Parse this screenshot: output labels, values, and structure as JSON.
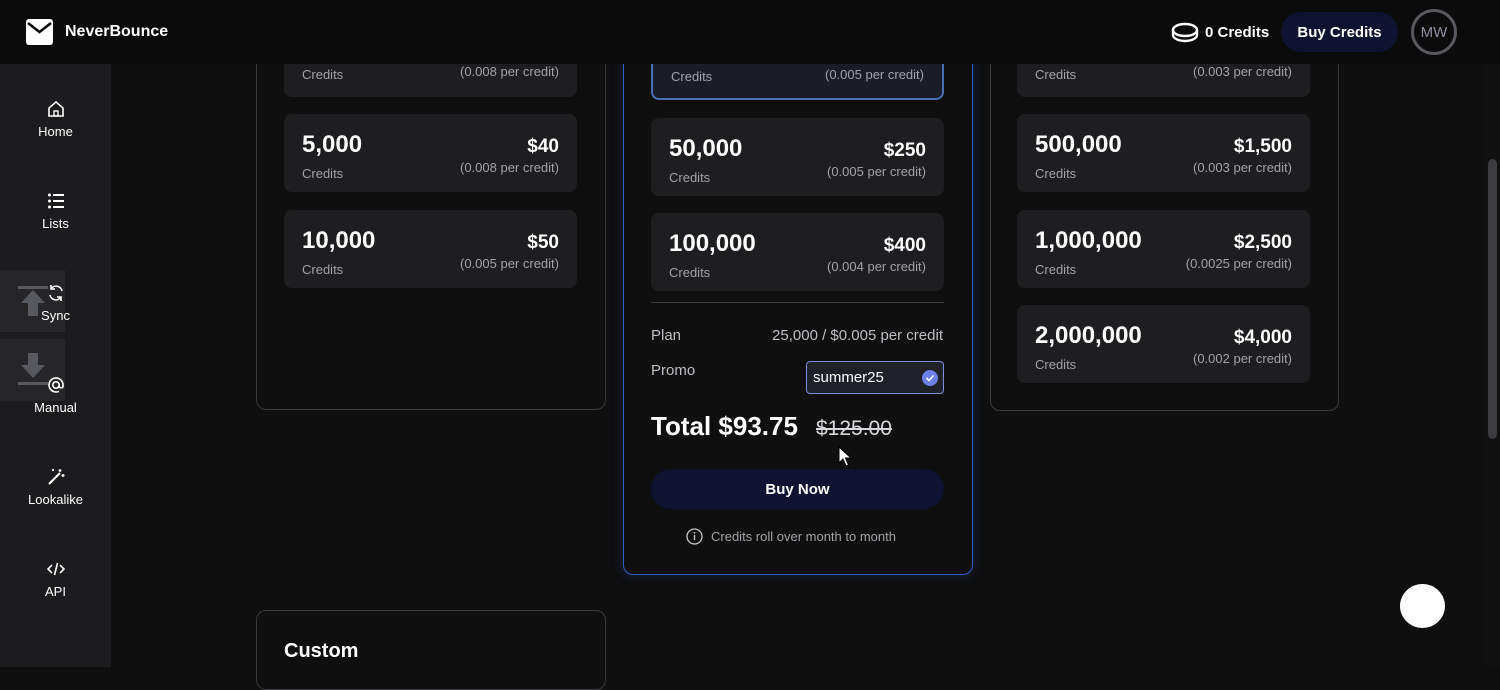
{
  "header": {
    "brand": "NeverBounce",
    "credits_text": "0 Credits",
    "buy_credits_label": "Buy Credits",
    "avatar_initials": "MW"
  },
  "sidebar": {
    "items": [
      {
        "label": "Home",
        "icon": "home-icon"
      },
      {
        "label": "Lists",
        "icon": "list-icon"
      },
      {
        "label": "Sync",
        "icon": "sync-icon"
      },
      {
        "label": "Manual",
        "icon": "at-icon"
      },
      {
        "label": "Lookalike",
        "icon": "wand-icon"
      },
      {
        "label": "API",
        "icon": "code-icon"
      }
    ]
  },
  "left_panel": {
    "tiers": [
      {
        "amount": "",
        "label": "Credits",
        "price": "",
        "per": "(0.008 per credit)"
      },
      {
        "amount": "5,000",
        "label": "Credits",
        "price": "$40",
        "per": "(0.008 per credit)"
      },
      {
        "amount": "10,000",
        "label": "Credits",
        "price": "$50",
        "per": "(0.005 per credit)"
      }
    ]
  },
  "center_panel": {
    "tiers": [
      {
        "amount": "",
        "label": "Credits",
        "price": "",
        "per": "(0.005 per credit)"
      },
      {
        "amount": "50,000",
        "label": "Credits",
        "price": "$250",
        "per": "(0.005 per credit)"
      },
      {
        "amount": "100,000",
        "label": "Credits",
        "price": "$400",
        "per": "(0.004 per credit)"
      }
    ],
    "plan_label": "Plan",
    "plan_value": "25,000 / $0.005 per credit",
    "promo_label": "Promo",
    "promo_value": "summer25",
    "total_text": "Total $93.75",
    "original_price": "$125.00",
    "buy_now_label": "Buy Now",
    "rollover_note": "Credits roll over month to month"
  },
  "right_panel": {
    "tiers": [
      {
        "amount": "",
        "label": "Credits",
        "price": "",
        "per": "(0.003 per credit)"
      },
      {
        "amount": "500,000",
        "label": "Credits",
        "price": "$1,500",
        "per": "(0.003 per credit)"
      },
      {
        "amount": "1,000,000",
        "label": "Credits",
        "price": "$2,500",
        "per": "(0.0025 per credit)"
      },
      {
        "amount": "2,000,000",
        "label": "Credits",
        "price": "$4,000",
        "per": "(0.002 per credit)"
      }
    ]
  },
  "custom_panel": {
    "title": "Custom"
  },
  "colors": {
    "accent_navy": "#0d1330",
    "selected_border": "#4a6fb8",
    "featured_border": "#2f5fc4",
    "check_blue": "#6d7fe8"
  }
}
